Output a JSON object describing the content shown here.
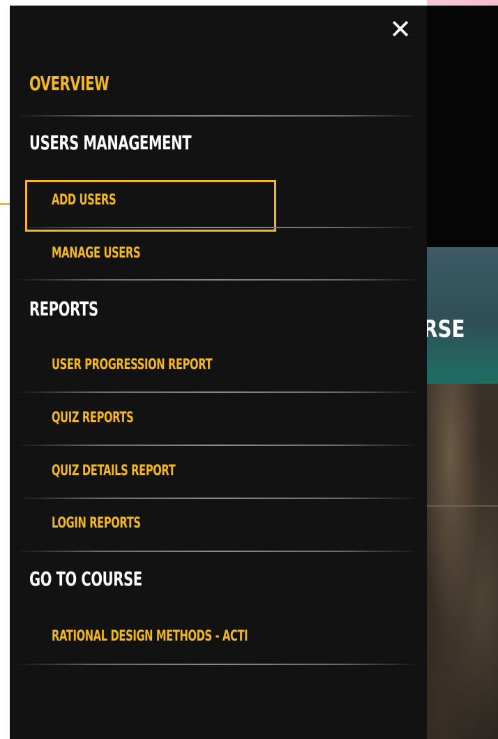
{
  "drawer": {
    "close_icon": "close-icon",
    "overview": "OVERVIEW",
    "users_management": {
      "label": "USERS MANAGEMENT",
      "items": [
        "ADD USERS",
        "MANAGE USERS"
      ]
    },
    "reports": {
      "label": "REPORTS",
      "items": [
        "USER PROGRESSION REPORT",
        "QUIZ REPORTS",
        "QUIZ DETAILS REPORT",
        "LOGIN REPORTS"
      ]
    },
    "go_to_course": {
      "label": "GO TO COURSE",
      "items": [
        "RATIONAL DESIGN METHODS - ACTI"
      ]
    },
    "highlighted_item": "ADD USERS"
  },
  "background": {
    "heading_fragment": "RSE"
  },
  "colors": {
    "accent": "#f4b81c",
    "drawer_bg": "#121212",
    "heading_text": "#ffffff"
  }
}
